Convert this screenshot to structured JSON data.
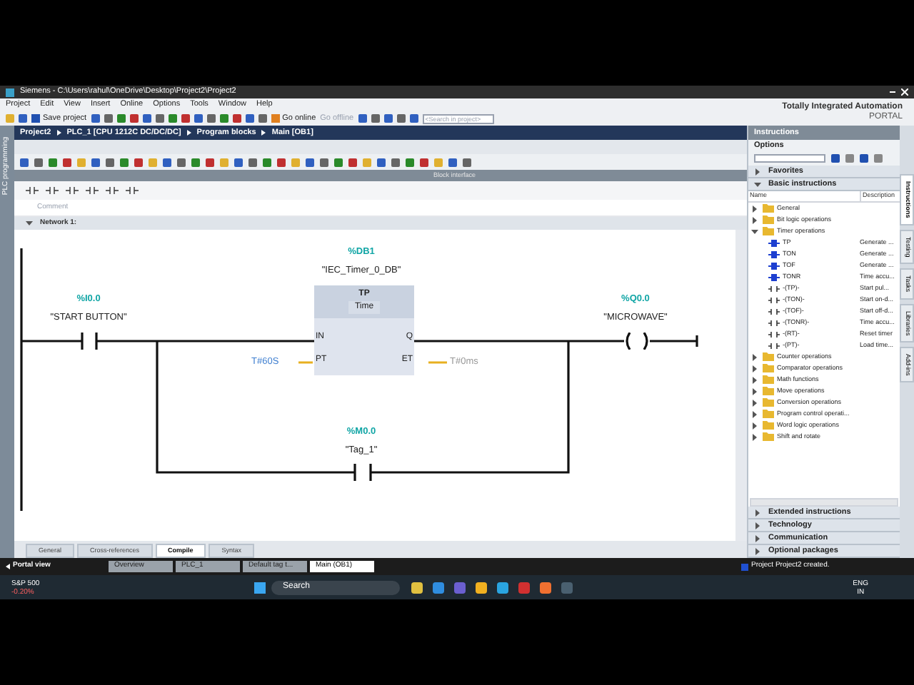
{
  "window": {
    "title": "Siemens  -  C:\\Users\\rahul\\OneDrive\\Desktop\\Project2\\Project2"
  },
  "menu": [
    "Project",
    "Edit",
    "View",
    "Insert",
    "Online",
    "Options",
    "Tools",
    "Window",
    "Help"
  ],
  "toolbar": {
    "save": "Save project",
    "go_online": "Go online",
    "go_offline": "Go offline",
    "search": {
      "placeholder": "<Search in project>"
    }
  },
  "brand": {
    "line1": "Totally Integrated Automation",
    "line2": "PORTAL"
  },
  "breadcrumb": [
    "Project2",
    "PLC_1 [CPU 1212C DC/DC/DC]",
    "Program blocks",
    "Main [OB1]"
  ],
  "side_label": "PLC programming",
  "block_interface": "Block interface",
  "comment": {
    "placeholder": "Comment"
  },
  "network": {
    "title": "Network 1:"
  },
  "ladder": {
    "contact_main": {
      "address": "%I0.0",
      "tag": "\"START BUTTON\""
    },
    "timer": {
      "address": "%DB1",
      "instance": "\"IEC_Timer_0_DB\"",
      "type": "TP",
      "subtitle": "Time",
      "in": "IN",
      "pt": "PT",
      "q": "Q",
      "et": "ET",
      "pt_value": "T#60S",
      "et_value": "T#0ms"
    },
    "coil": {
      "address": "%Q0.0",
      "tag": "\"MICROWAVE\""
    },
    "contact_branch": {
      "address": "%M0.0",
      "tag": "\"Tag_1\""
    }
  },
  "instructions": {
    "title": "Instructions",
    "options": "Options",
    "sections_top": [
      {
        "label": "Favorites",
        "expanded": false
      },
      {
        "label": "Basic instructions",
        "expanded": true
      }
    ],
    "columns": [
      "Name",
      "Description"
    ],
    "tree": [
      {
        "name": "General",
        "kind": "folder",
        "expanded": false
      },
      {
        "name": "Bit logic operations",
        "kind": "folder",
        "expanded": false
      },
      {
        "name": "Timer operations",
        "kind": "folder",
        "expanded": true,
        "children": [
          {
            "name": "TP",
            "kind": "box",
            "description": "Generate ..."
          },
          {
            "name": "TON",
            "kind": "box",
            "description": "Generate ..."
          },
          {
            "name": "TOF",
            "kind": "box",
            "description": "Generate ..."
          },
          {
            "name": "TONR",
            "kind": "box",
            "description": "Time accu..."
          },
          {
            "name": "-(TP)-",
            "kind": "coil",
            "description": "Start pul..."
          },
          {
            "name": "-(TON)-",
            "kind": "coil",
            "description": "Start on-d..."
          },
          {
            "name": "-(TOF)-",
            "kind": "coil",
            "description": "Start off-d..."
          },
          {
            "name": "-(TONR)-",
            "kind": "coil",
            "description": "Time accu..."
          },
          {
            "name": "-(RT)-",
            "kind": "coil",
            "description": "Reset timer"
          },
          {
            "name": "-(PT)-",
            "kind": "coil",
            "description": "Load time..."
          }
        ]
      },
      {
        "name": "Counter operations",
        "kind": "folder",
        "expanded": false
      },
      {
        "name": "Comparator operations",
        "kind": "folder",
        "expanded": false
      },
      {
        "name": "Math functions",
        "kind": "folder",
        "expanded": false
      },
      {
        "name": "Move operations",
        "kind": "folder",
        "expanded": false
      },
      {
        "name": "Conversion operations",
        "kind": "folder",
        "expanded": false
      },
      {
        "name": "Program control operati...",
        "kind": "folder",
        "expanded": false
      },
      {
        "name": "Word logic operations",
        "kind": "folder",
        "expanded": false
      },
      {
        "name": "Shift and rotate",
        "kind": "folder",
        "expanded": false
      }
    ],
    "sections_bottom": [
      {
        "label": "Extended instructions",
        "expanded": false
      },
      {
        "label": "Technology",
        "expanded": false
      },
      {
        "label": "Communication",
        "expanded": false
      },
      {
        "label": "Optional packages",
        "expanded": false
      }
    ]
  },
  "side_tabs": [
    {
      "label": "Instructions",
      "selected": true
    },
    {
      "label": "Testing",
      "selected": false
    },
    {
      "label": "Tasks",
      "selected": false
    },
    {
      "label": "Libraries",
      "selected": false
    },
    {
      "label": "Add-ins",
      "selected": false
    }
  ],
  "inspector_tabs": [
    {
      "label": "General",
      "selected": false
    },
    {
      "label": "Cross-references",
      "selected": false
    },
    {
      "label": "Compile",
      "selected": true
    },
    {
      "label": "Syntax",
      "selected": false
    }
  ],
  "portal_bar": {
    "portal_view": "Portal view",
    "editors": [
      {
        "label": "Overview",
        "selected": false
      },
      {
        "label": "PLC_1",
        "selected": false
      },
      {
        "label": "Default tag t...",
        "selected": false
      },
      {
        "label": "Main (OB1)",
        "selected": true
      }
    ],
    "status": "Project Project2 created."
  },
  "taskbar": {
    "stock": "S&P 500",
    "change": "-0.20%",
    "search": "Search",
    "lang": "ENG",
    "region": "IN"
  }
}
